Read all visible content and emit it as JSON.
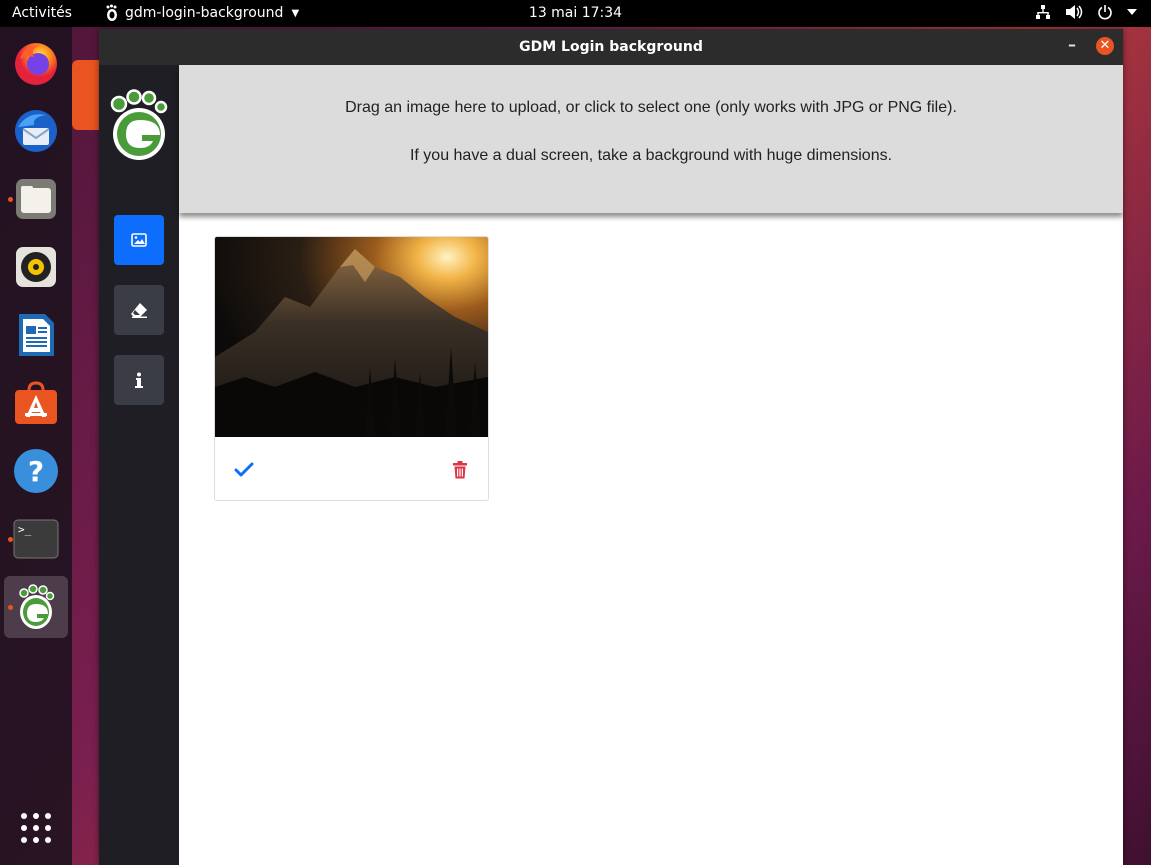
{
  "topbar": {
    "activities": "Activités",
    "app_name": "gdm-login-background",
    "clock": "13 mai  17:34",
    "icons": [
      "network-icon",
      "volume-icon",
      "power-icon",
      "menu-caret-icon"
    ]
  },
  "dock": {
    "items": [
      {
        "name": "firefox",
        "icon": "firefox-icon",
        "running": false,
        "active": false
      },
      {
        "name": "thunderbird",
        "icon": "thunderbird-icon",
        "running": false,
        "active": false
      },
      {
        "name": "files",
        "icon": "files-icon",
        "running": true,
        "active": false
      },
      {
        "name": "rhythmbox",
        "icon": "rhythmbox-icon",
        "running": false,
        "active": false
      },
      {
        "name": "libreoffice-writer",
        "icon": "writer-icon",
        "running": false,
        "active": false
      },
      {
        "name": "ubuntu-software",
        "icon": "software-icon",
        "running": false,
        "active": false
      },
      {
        "name": "help",
        "icon": "help-icon",
        "running": false,
        "active": false
      },
      {
        "name": "terminal",
        "icon": "terminal-icon",
        "running": true,
        "active": false
      },
      {
        "name": "gdm-login-background",
        "icon": "gnome-foot-icon",
        "running": true,
        "active": true
      }
    ],
    "show_apps_icon": "grid-icon"
  },
  "window": {
    "title": "GDM Login background",
    "minimize_label": "–",
    "close_label": "✕",
    "sidebar": {
      "buttons": [
        {
          "name": "images",
          "icon": "image-icon",
          "active": true
        },
        {
          "name": "reset",
          "icon": "eraser-icon",
          "active": false
        },
        {
          "name": "about",
          "icon": "info-icon",
          "active": false
        }
      ]
    },
    "dropzone": {
      "line1": "Drag an image here to upload, or click to select one (only works with JPG or PNG file).",
      "line2": "If you have a dual screen, take a background with huge dimensions."
    },
    "images": [
      {
        "thumbnail": "mountain-sunset-photo",
        "actions": [
          "apply",
          "delete"
        ]
      }
    ]
  },
  "colors": {
    "accent_blue": "#0d6efd",
    "delete_red": "#dc3545",
    "ubuntu_orange": "#e95420",
    "sidebar_bg": "#1e1e24"
  }
}
